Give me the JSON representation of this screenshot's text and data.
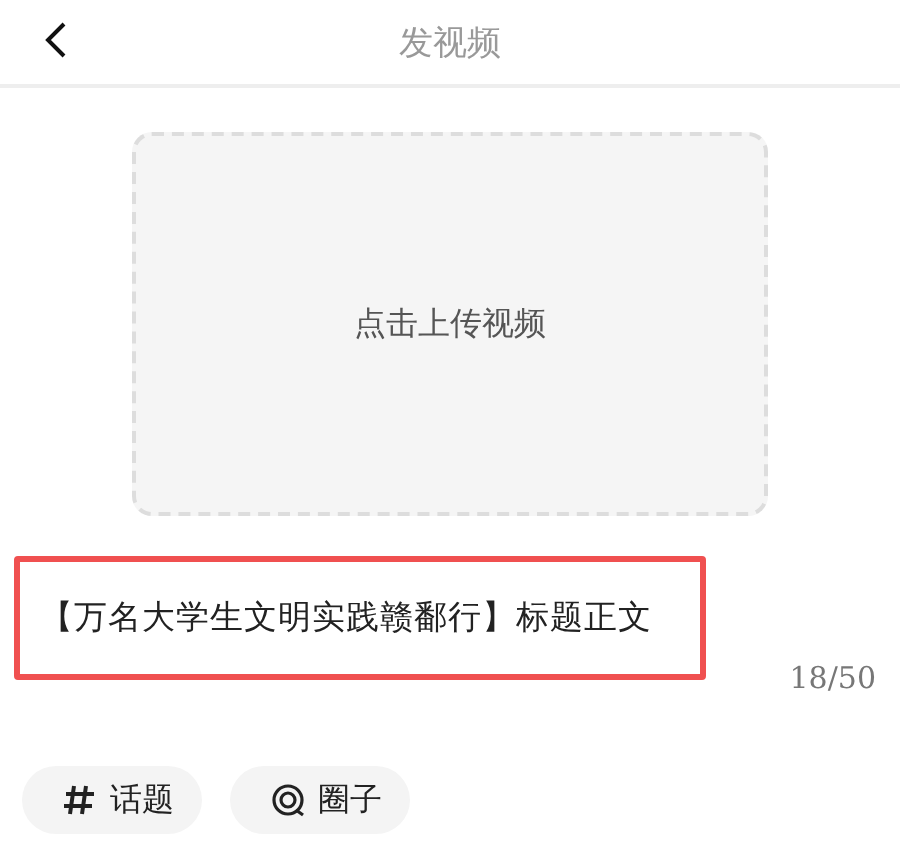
{
  "header": {
    "title": "发视频"
  },
  "upload": {
    "label": "点击上传视频"
  },
  "title_field": {
    "value": "【万名大学生文明实践赣鄱行】标题正文",
    "highlighted": true,
    "counter": "18/50"
  },
  "chips": [
    {
      "kind": "topic",
      "label": "话题"
    },
    {
      "kind": "circle",
      "label": "圈子"
    }
  ]
}
